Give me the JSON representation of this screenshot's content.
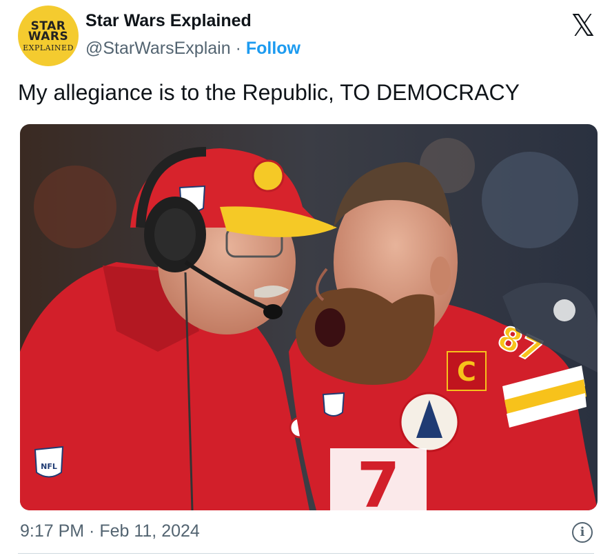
{
  "header": {
    "avatar_text": [
      "STAR",
      "WARS",
      "EXPLAINED"
    ],
    "display_name": "Star Wars Explained",
    "handle": "@StarWarsExplain",
    "separator": " · ",
    "follow_label": "Follow",
    "x_logo": "𝕏"
  },
  "tweet": {
    "text": "My allegiance is to the Republic, TO DEMOCRACY"
  },
  "media": {
    "nfl_shield_text": "NFL",
    "jersey_number": "87",
    "captain_patch": "C",
    "front_number": "7"
  },
  "footer": {
    "timestamp": "9:17 PM · Feb 11, 2024",
    "info_icon": "i"
  },
  "colors": {
    "link_blue": "#1d9bf0",
    "secondary_text": "#536471",
    "chiefs_red": "#d21f2a",
    "chiefs_gold": "#f7c21b",
    "avatar_yellow": "#f4cb2f"
  }
}
